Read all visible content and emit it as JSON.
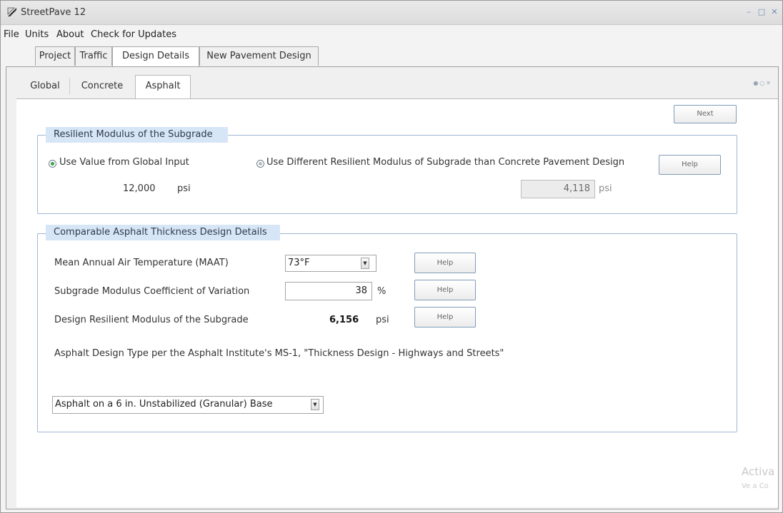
{
  "window": {
    "title": "StreetPave 12"
  },
  "menu": [
    "File",
    "Units",
    "About",
    "Check for Updates"
  ],
  "top_tabs": [
    "Project",
    "Traffic",
    "Design Details",
    "New Pavement Design"
  ],
  "sub_tabs": [
    "Global",
    "Concrete",
    "Asphalt"
  ],
  "next_label": "Next",
  "subgrade": {
    "title": "Resilient Modulus of the Subgrade",
    "option_global": "Use Value from Global Input",
    "option_different": "Use Different Resilient Modulus of Subgrade than Concrete Pavement Design",
    "help_label": "Help",
    "global_value": "12,000",
    "global_unit": "psi",
    "different_value": "4,118",
    "different_unit": "psi"
  },
  "asphalt": {
    "title": "Comparable Asphalt Thickness Design Details",
    "maat_label": "Mean Annual Air Temperature (MAAT)",
    "maat_value": "73°F",
    "cov_label": "Subgrade Modulus Coefficient of Variation",
    "cov_value": "38",
    "cov_unit": "%",
    "design_label": "Design Resilient Modulus of the Subgrade",
    "design_value": "6,156",
    "design_unit": "psi",
    "help_label": "Help",
    "type_label": "Asphalt Design Type per the Asphalt Institute's MS-1, \"Thickness Design - Highways and Streets\"",
    "type_value": "Asphalt on a 6 in. Unstabilized (Granular) Base"
  },
  "watermark": {
    "line1": "Activa",
    "line2": "Ve a Co"
  },
  "colors": {
    "radio_selected": "#3f9d4a",
    "group_header": "#d7e6f7",
    "group_border": "#9fb7d6"
  },
  "icons": {
    "app": "streetpave-app-icon",
    "dropdown": "chevron-down-icon",
    "radio": "radio-button-icon"
  }
}
